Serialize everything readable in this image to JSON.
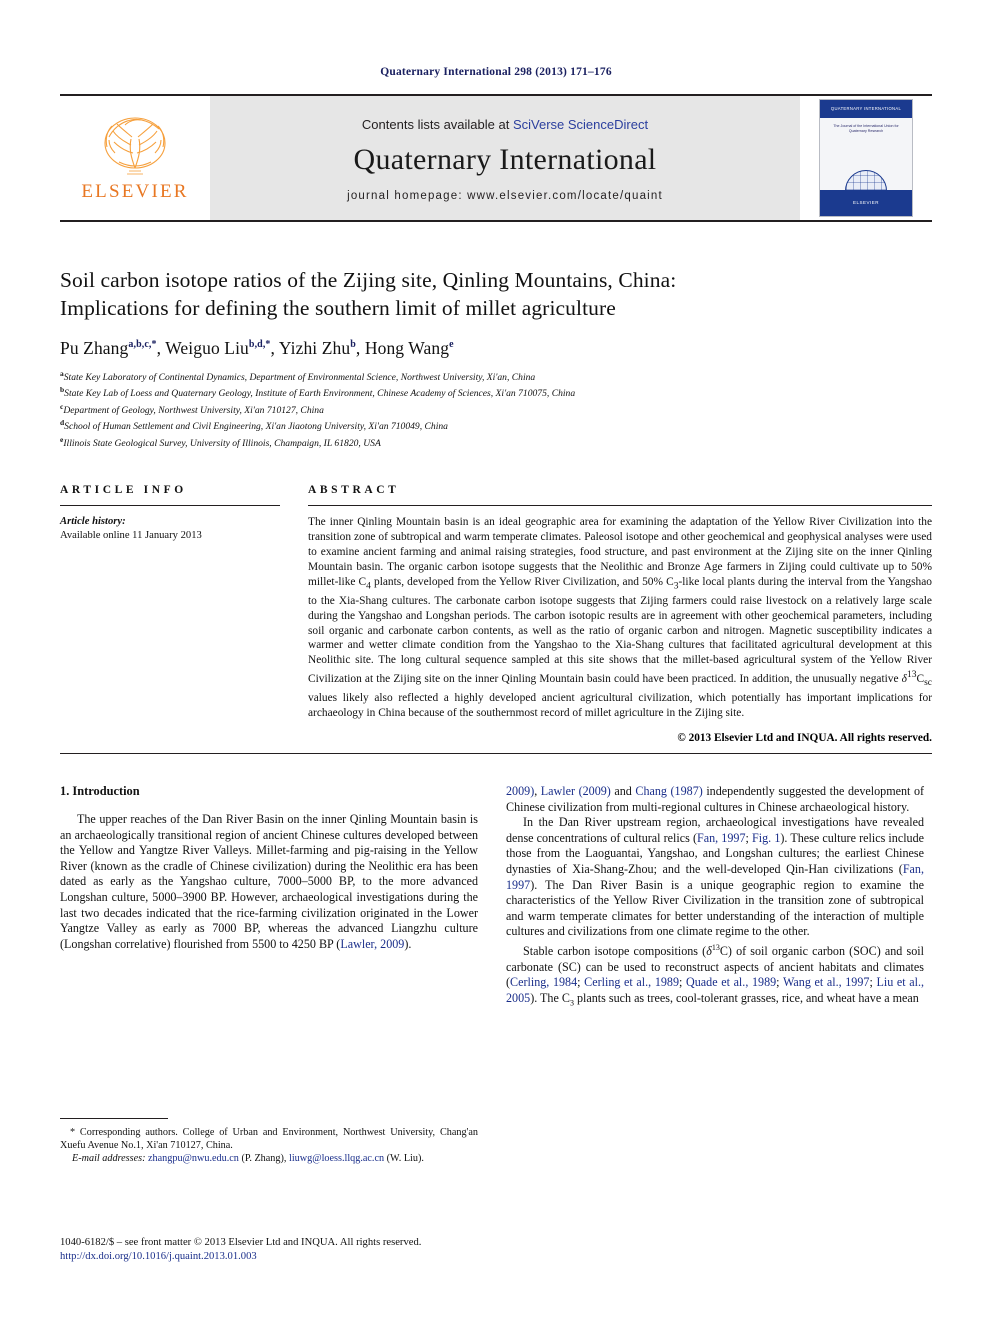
{
  "running_head": "Quaternary International 298 (2013) 171–176",
  "masthead": {
    "publisher_name": "ELSEVIER",
    "contents_prefix": "Contents lists available at ",
    "contents_link": "SciVerse ScienceDirect",
    "journal_title": "Quaternary International",
    "homepage": "journal homepage: www.elsevier.com/locate/quaint",
    "cover": {
      "top_banner": "QUATERNARY INTERNATIONAL",
      "title_lines": "The Journal of the International Union for Quaternary Research",
      "bottom_brand": "ELSEVIER"
    }
  },
  "article": {
    "title_line1": "Soil carbon isotope ratios of the Zijing site, Qinling Mountains, China:",
    "title_line2": "Implications for defining the southern limit of millet agriculture",
    "authors": [
      {
        "name": "Pu Zhang",
        "marks": "a,b,c,*"
      },
      {
        "name": "Weiguo Liu",
        "marks": "b,d,*"
      },
      {
        "name": "Yizhi Zhu",
        "marks": "b"
      },
      {
        "name": "Hong Wang",
        "marks": "e"
      }
    ],
    "affiliations": [
      {
        "mark": "a",
        "text": "State Key Laboratory of Continental Dynamics, Department of Environmental Science, Northwest University, Xi'an, China"
      },
      {
        "mark": "b",
        "text": "State Key Lab of Loess and Quaternary Geology, Institute of Earth Environment, Chinese Academy of Sciences, Xi'an 710075, China"
      },
      {
        "mark": "c",
        "text": "Department of Geology, Northwest University, Xi'an 710127, China"
      },
      {
        "mark": "d",
        "text": "School of Human Settlement and Civil Engineering, Xi'an Jiaotong University, Xi'an 710049, China"
      },
      {
        "mark": "e",
        "text": "Illinois State Geological Survey, University of Illinois, Champaign, IL 61820, USA"
      }
    ]
  },
  "article_info": {
    "label": "ARTICLE INFO",
    "history_label": "Article history:",
    "history_value": "Available online 11 January 2013"
  },
  "abstract": {
    "label": "ABSTRACT",
    "text": "The inner Qinling Mountain basin is an ideal geographic area for examining the adaptation of the Yellow River Civilization into the transition zone of subtropical and warm temperate climates. Paleosol isotope and other geochemical and geophysical analyses were used to examine ancient farming and animal raising strategies, food structure, and past environment at the Zijing site on the inner Qinling Mountain basin. The organic carbon isotope suggests that the Neolithic and Bronze Age farmers in Zijing could cultivate up to 50% millet-like C4 plants, developed from the Yellow River Civilization, and 50% C3-like local plants during the interval from the Yangshao to the Xia-Shang cultures. The carbonate carbon isotope suggests that Zijing farmers could raise livestock on a relatively large scale during the Yangshao and Longshan periods. The carbon isotopic results are in agreement with other geochemical parameters, including soil organic and carbonate carbon contents, as well as the ratio of organic carbon and nitrogen. Magnetic susceptibility indicates a warmer and wetter climate condition from the Yangshao to the Xia-Shang cultures that facilitated agricultural development at this Neolithic site. The long cultural sequence sampled at this site shows that the millet-based agricultural system of the Yellow River Civilization at the Zijing site on the inner Qinling Mountain basin could have been practiced. In addition, the unusually negative δ13Csc values likely also reflected a highly developed ancient agricultural civilization, which potentially has important implications for archaeology in China because of the southernmost record of millet agriculture in the Zijing site.",
    "copyright": "© 2013 Elsevier Ltd and INQUA. All rights reserved."
  },
  "introduction": {
    "heading": "1. Introduction",
    "para1": "The upper reaches of the Dan River Basin on the inner Qinling Mountain basin is an archaeologically transitional region of ancient Chinese cultures developed between the Yellow and Yangtze River Valleys. Millet-farming and pig-raising in the Yellow River (known as the cradle of Chinese civilization) during the Neolithic era has been dated as early as the Yangshao culture, 7000–5000 BP, to the more advanced Longshan culture, 5000–3900 BP. However, archaeological investigations during the last two decades indicated that the rice-farming civilization originated in the Lower Yangtze Valley as early as 7000 BP, whereas the advanced Liangzhu culture (Longshan correlative) flourished from 5500 to 4250 BP (",
    "para1_ref_tail": "Lawler, 2009",
    "para1_cont": "). ",
    "para2_refs_a": "Lawler (2009)",
    "para2_and": " and ",
    "para2_refs_b": "Chang (1987)",
    "para2_rest": " independently suggested the development of Chinese civilization from multi-regional cultures in Chinese archaeological history.",
    "para3_a": "In the Dan River upstream region, archaeological investigations have revealed dense concentrations of cultural relics (",
    "para3_ref1": "Fan, 1997",
    "para3_b": "; ",
    "para3_ref2": "Fig. 1",
    "para3_c": "). These culture relics include those from the Laoguantai, Yangshao, and Longshan cultures; the earliest Chinese dynasties of Xia-Shang-Zhou; and the well-developed Qin-Han civilizations (",
    "para3_ref3": "Fan, 1997",
    "para3_d": "). The Dan River Basin is a unique geographic region to examine the characteristics of the Yellow River Civilization in the transition zone of subtropical and warm temperate climates for better understanding of the interaction of multiple cultures and civilizations from one climate regime to the other.",
    "para4_a": "Stable carbon isotope compositions (δ13C) of soil organic carbon (SOC) and soil carbonate (SC) can be used to reconstruct aspects of ancient habitats and climates (",
    "para4_ref1": "Cerling, 1984",
    "para4_sep1": "; ",
    "para4_ref2": "Cerling et al., 1989",
    "para4_sep2": "; ",
    "para4_ref3": "Quade et al., 1989",
    "para4_sep3": "; ",
    "para4_ref4": "Wang et al., 1997",
    "para4_sep4": "; ",
    "para4_ref5": "Liu et al., 2005",
    "para4_b": "). The C3 plants such as trees, cool-tolerant grasses, rice, and wheat have a mean"
  },
  "footnotes": {
    "corresponding": "* Corresponding authors. College of Urban and Environment, Northwest University, Chang'an Xuefu Avenue No.1, Xi'an 710127, China.",
    "email_label": "E-mail addresses:",
    "email1": "zhangpu@nwu.edu.cn",
    "email1_owner": " (P. Zhang), ",
    "email2": "liuwg@loess.llqg.ac.cn",
    "email2_owner": " (W. Liu)."
  },
  "colophon": {
    "issn_line": "1040-6182/$ – see front matter © 2013 Elsevier Ltd and INQUA. All rights reserved.",
    "doi": "http://dx.doi.org/10.1016/j.quaint.2013.01.003"
  }
}
